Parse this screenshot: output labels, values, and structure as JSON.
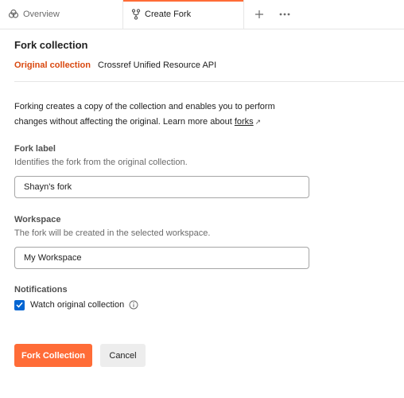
{
  "tabs": {
    "overview_label": "Overview",
    "create_fork_label": "Create Fork",
    "add_icon": "plus-icon",
    "more_icon": "more-horizontal-icon"
  },
  "header": {
    "title": "Fork collection",
    "original_label": "Original collection",
    "original_value": "Crossref Unified Resource API"
  },
  "description": {
    "text": "Forking creates a copy of the collection and enables you to perform changes without affecting the original. Learn more about ",
    "link": "forks",
    "link_arrow": "↗"
  },
  "fork_label": {
    "label": "Fork label",
    "hint": "Identifies the fork from the original collection.",
    "value": "Shayn's fork"
  },
  "workspace": {
    "label": "Workspace",
    "hint": "The fork will be created in the selected workspace.",
    "value": "My Workspace"
  },
  "notifications": {
    "label": "Notifications",
    "watch_label": "Watch original collection",
    "watch_checked": true
  },
  "actions": {
    "primary": "Fork Collection",
    "secondary": "Cancel"
  },
  "colors": {
    "accent": "#ff6c37",
    "original_label": "#d9480f",
    "checkbox": "#0265d2"
  }
}
